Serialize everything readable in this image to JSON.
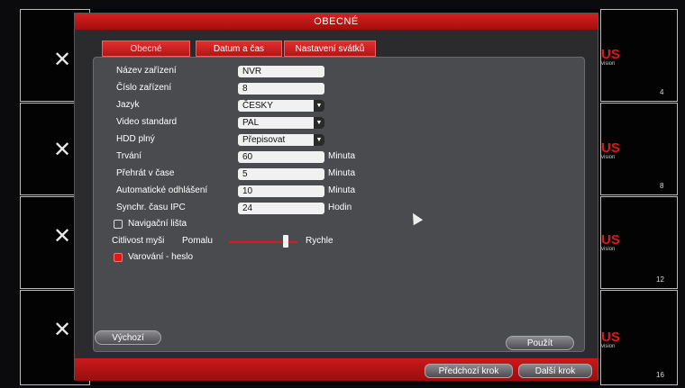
{
  "background": {
    "brand_text": "US",
    "brand_sub": "vision",
    "channel_numbers": [
      "4",
      "8",
      "12",
      "16"
    ],
    "brand_color": "#e01818"
  },
  "dialog": {
    "title": "OBECNÉ",
    "tabs": [
      {
        "label": "Obecné"
      },
      {
        "label": "Datum a čas"
      },
      {
        "label": "Nastavení svátků"
      }
    ],
    "fields": {
      "device_name": {
        "label": "Název zařízení",
        "value": "NVR"
      },
      "device_number": {
        "label": "Číslo zařízení",
        "value": "8"
      },
      "language": {
        "label": "Jazyk",
        "value": "ČESKY"
      },
      "video_standard": {
        "label": "Video standard",
        "value": "PAL"
      },
      "hdd_full": {
        "label": "HDD plný",
        "value": "Přepisovat"
      },
      "duration": {
        "label": "Trvání",
        "value": "60",
        "unit": "Minuta"
      },
      "instant_play": {
        "label": "Přehrát v čase",
        "value": "5",
        "unit": "Minuta"
      },
      "auto_logout": {
        "label": "Automatické odhlášení",
        "value": "10",
        "unit": "Minuta"
      },
      "ipc_sync": {
        "label": "Synchr. času IPC",
        "value": "24",
        "unit": "Hodin"
      }
    },
    "nav_bar": {
      "label": "Navigační lišta",
      "checked": false
    },
    "mouse_sensitivity": {
      "label": "Citlivost myši",
      "min_label": "Pomalu",
      "max_label": "Rychle",
      "level": 0.83
    },
    "password_warning": {
      "label": "Varování - heslo",
      "checked": true
    },
    "buttons": {
      "default": "Výchozí",
      "apply": "Použít",
      "prev": "Předchozí krok",
      "next": "Další krok"
    }
  }
}
